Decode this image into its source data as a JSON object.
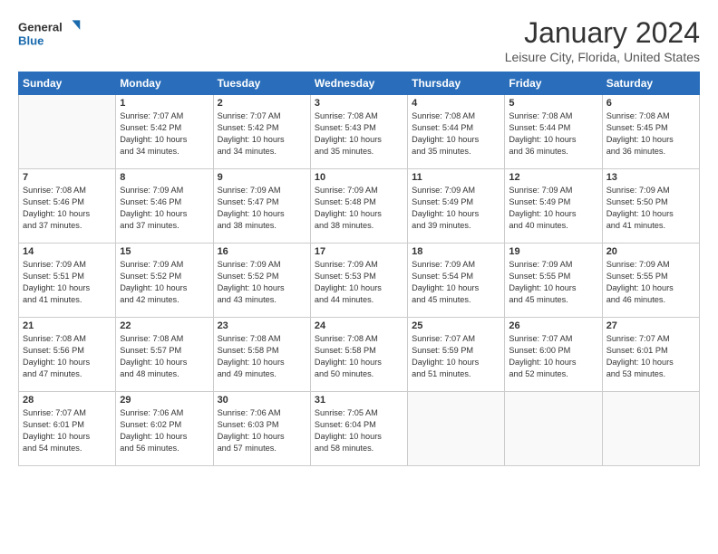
{
  "app": {
    "name_general": "General",
    "name_blue": "Blue"
  },
  "header": {
    "month": "January 2024",
    "location": "Leisure City, Florida, United States"
  },
  "weekdays": [
    "Sunday",
    "Monday",
    "Tuesday",
    "Wednesday",
    "Thursday",
    "Friday",
    "Saturday"
  ],
  "weeks": [
    [
      {
        "day": "",
        "info": ""
      },
      {
        "day": "1",
        "info": "Sunrise: 7:07 AM\nSunset: 5:42 PM\nDaylight: 10 hours\nand 34 minutes."
      },
      {
        "day": "2",
        "info": "Sunrise: 7:07 AM\nSunset: 5:42 PM\nDaylight: 10 hours\nand 34 minutes."
      },
      {
        "day": "3",
        "info": "Sunrise: 7:08 AM\nSunset: 5:43 PM\nDaylight: 10 hours\nand 35 minutes."
      },
      {
        "day": "4",
        "info": "Sunrise: 7:08 AM\nSunset: 5:44 PM\nDaylight: 10 hours\nand 35 minutes."
      },
      {
        "day": "5",
        "info": "Sunrise: 7:08 AM\nSunset: 5:44 PM\nDaylight: 10 hours\nand 36 minutes."
      },
      {
        "day": "6",
        "info": "Sunrise: 7:08 AM\nSunset: 5:45 PM\nDaylight: 10 hours\nand 36 minutes."
      }
    ],
    [
      {
        "day": "7",
        "info": "Sunrise: 7:08 AM\nSunset: 5:46 PM\nDaylight: 10 hours\nand 37 minutes."
      },
      {
        "day": "8",
        "info": "Sunrise: 7:09 AM\nSunset: 5:46 PM\nDaylight: 10 hours\nand 37 minutes."
      },
      {
        "day": "9",
        "info": "Sunrise: 7:09 AM\nSunset: 5:47 PM\nDaylight: 10 hours\nand 38 minutes."
      },
      {
        "day": "10",
        "info": "Sunrise: 7:09 AM\nSunset: 5:48 PM\nDaylight: 10 hours\nand 38 minutes."
      },
      {
        "day": "11",
        "info": "Sunrise: 7:09 AM\nSunset: 5:49 PM\nDaylight: 10 hours\nand 39 minutes."
      },
      {
        "day": "12",
        "info": "Sunrise: 7:09 AM\nSunset: 5:49 PM\nDaylight: 10 hours\nand 40 minutes."
      },
      {
        "day": "13",
        "info": "Sunrise: 7:09 AM\nSunset: 5:50 PM\nDaylight: 10 hours\nand 41 minutes."
      }
    ],
    [
      {
        "day": "14",
        "info": "Sunrise: 7:09 AM\nSunset: 5:51 PM\nDaylight: 10 hours\nand 41 minutes."
      },
      {
        "day": "15",
        "info": "Sunrise: 7:09 AM\nSunset: 5:52 PM\nDaylight: 10 hours\nand 42 minutes."
      },
      {
        "day": "16",
        "info": "Sunrise: 7:09 AM\nSunset: 5:52 PM\nDaylight: 10 hours\nand 43 minutes."
      },
      {
        "day": "17",
        "info": "Sunrise: 7:09 AM\nSunset: 5:53 PM\nDaylight: 10 hours\nand 44 minutes."
      },
      {
        "day": "18",
        "info": "Sunrise: 7:09 AM\nSunset: 5:54 PM\nDaylight: 10 hours\nand 45 minutes."
      },
      {
        "day": "19",
        "info": "Sunrise: 7:09 AM\nSunset: 5:55 PM\nDaylight: 10 hours\nand 45 minutes."
      },
      {
        "day": "20",
        "info": "Sunrise: 7:09 AM\nSunset: 5:55 PM\nDaylight: 10 hours\nand 46 minutes."
      }
    ],
    [
      {
        "day": "21",
        "info": "Sunrise: 7:08 AM\nSunset: 5:56 PM\nDaylight: 10 hours\nand 47 minutes."
      },
      {
        "day": "22",
        "info": "Sunrise: 7:08 AM\nSunset: 5:57 PM\nDaylight: 10 hours\nand 48 minutes."
      },
      {
        "day": "23",
        "info": "Sunrise: 7:08 AM\nSunset: 5:58 PM\nDaylight: 10 hours\nand 49 minutes."
      },
      {
        "day": "24",
        "info": "Sunrise: 7:08 AM\nSunset: 5:58 PM\nDaylight: 10 hours\nand 50 minutes."
      },
      {
        "day": "25",
        "info": "Sunrise: 7:07 AM\nSunset: 5:59 PM\nDaylight: 10 hours\nand 51 minutes."
      },
      {
        "day": "26",
        "info": "Sunrise: 7:07 AM\nSunset: 6:00 PM\nDaylight: 10 hours\nand 52 minutes."
      },
      {
        "day": "27",
        "info": "Sunrise: 7:07 AM\nSunset: 6:01 PM\nDaylight: 10 hours\nand 53 minutes."
      }
    ],
    [
      {
        "day": "28",
        "info": "Sunrise: 7:07 AM\nSunset: 6:01 PM\nDaylight: 10 hours\nand 54 minutes."
      },
      {
        "day": "29",
        "info": "Sunrise: 7:06 AM\nSunset: 6:02 PM\nDaylight: 10 hours\nand 56 minutes."
      },
      {
        "day": "30",
        "info": "Sunrise: 7:06 AM\nSunset: 6:03 PM\nDaylight: 10 hours\nand 57 minutes."
      },
      {
        "day": "31",
        "info": "Sunrise: 7:05 AM\nSunset: 6:04 PM\nDaylight: 10 hours\nand 58 minutes."
      },
      {
        "day": "",
        "info": ""
      },
      {
        "day": "",
        "info": ""
      },
      {
        "day": "",
        "info": ""
      }
    ]
  ]
}
